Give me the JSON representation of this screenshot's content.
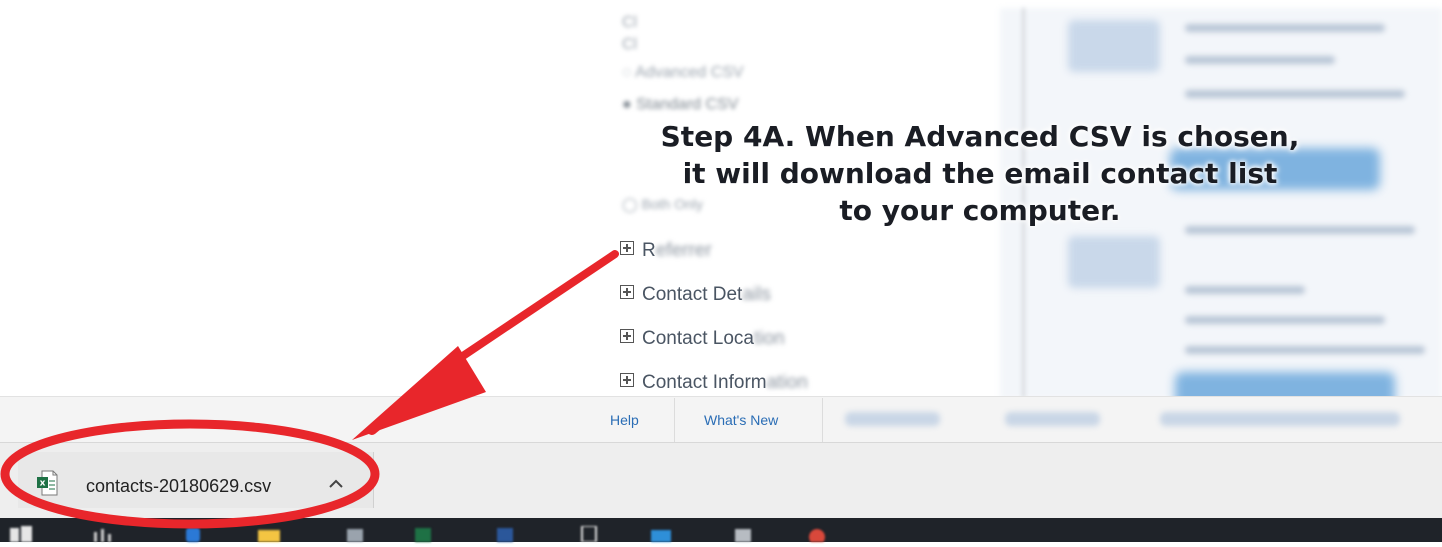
{
  "background_menu": {
    "faded_rows": [
      "Cl",
      "Cl",
      "Advanced CSV",
      "Standard CSV"
    ],
    "both_row": "Both Only",
    "tree_items": [
      {
        "label_start": "R",
        "label_end": "eferrer"
      },
      {
        "label_start": "Contact Det",
        "label_end": "ails"
      },
      {
        "label_start": "Contact Loca",
        "label_end": "tion"
      },
      {
        "label_start": "Contact Inform",
        "label_end": "ation"
      }
    ]
  },
  "annotation": {
    "line1": "Step 4A. When Advanced CSV is chosen,",
    "line2": "it will download the email contact list",
    "line3": "to your computer.",
    "accent_color": "#e8262b"
  },
  "footer": {
    "help_label": "Help",
    "whats_new_label": "What's New",
    "blurred_links": [
      "Privacy Policy",
      "Terms",
      "Contact"
    ]
  },
  "download_bar": {
    "file_name": "contacts-20180629.csv",
    "file_icon": "excel-csv-icon",
    "menu_icon": "chevron-up-icon"
  },
  "taskbar": {
    "icons": [
      "start-icon",
      "task-view-icon",
      "edge-icon",
      "file-explorer-icon",
      "store-icon",
      "excel-icon",
      "word-icon",
      "tablet-icon",
      "mail-icon",
      "app-icon",
      "chrome-icon"
    ]
  },
  "colors": {
    "link": "#2a6db5",
    "excel_green": "#1e7145",
    "taskbar": "#1f2329"
  }
}
